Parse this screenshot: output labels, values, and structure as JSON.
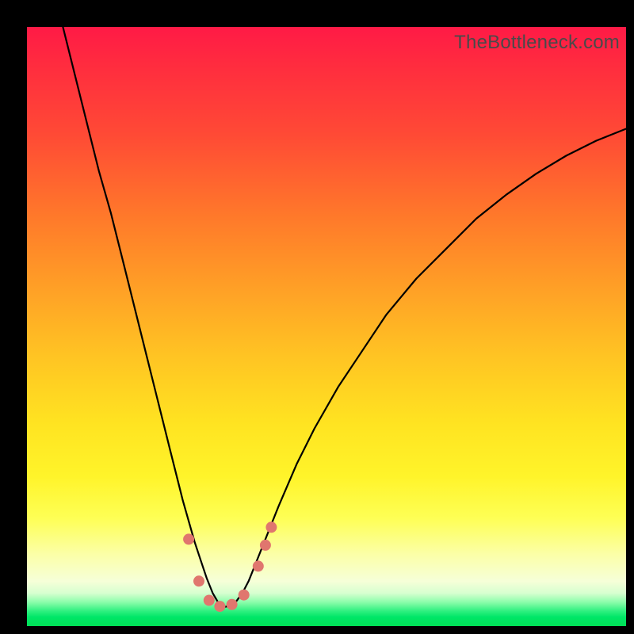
{
  "watermark": "TheBottleneck.com",
  "colors": {
    "frame": "#000000",
    "gradient_top": "#ff1a46",
    "gradient_mid": "#ffe321",
    "gradient_bottom": "#00e156",
    "curve": "#000000",
    "marker": "#e0766e"
  },
  "chart_data": {
    "type": "line",
    "title": "",
    "xlabel": "",
    "ylabel": "",
    "xlim": [
      0,
      100
    ],
    "ylim": [
      0,
      100
    ],
    "grid": false,
    "legend": false,
    "note": "Axis units unlabeled in source; x spans plot width (0=left,100=right), y is bottleneck magnitude (0=bottom/green,100=top/red). Curve is a V with minimum near x≈33.",
    "series": [
      {
        "name": "bottleneck-curve",
        "x": [
          6,
          8,
          10,
          12,
          14,
          16,
          18,
          20,
          22,
          24,
          26,
          28,
          29,
          30,
          31,
          32,
          33,
          34,
          35,
          36,
          37,
          38,
          40,
          42,
          45,
          48,
          52,
          56,
          60,
          65,
          70,
          75,
          80,
          85,
          90,
          95,
          100
        ],
        "y": [
          100,
          92,
          84,
          76,
          69,
          61,
          53,
          45,
          37,
          29,
          21,
          14,
          11,
          8,
          5.5,
          3.8,
          3.2,
          3.4,
          4.2,
          5.6,
          7.5,
          10,
          15,
          20,
          27,
          33,
          40,
          46,
          52,
          58,
          63,
          68,
          72,
          75.5,
          78.5,
          81,
          83
        ]
      }
    ],
    "markers": {
      "name": "highlight-dots",
      "points": [
        {
          "x": 27.0,
          "y": 14.5
        },
        {
          "x": 28.7,
          "y": 7.5
        },
        {
          "x": 30.4,
          "y": 4.3
        },
        {
          "x": 32.2,
          "y": 3.3
        },
        {
          "x": 34.2,
          "y": 3.6
        },
        {
          "x": 36.2,
          "y": 5.2
        },
        {
          "x": 38.6,
          "y": 10.0
        },
        {
          "x": 39.8,
          "y": 13.5
        },
        {
          "x": 40.8,
          "y": 16.5
        }
      ],
      "radius_px": 7
    }
  }
}
